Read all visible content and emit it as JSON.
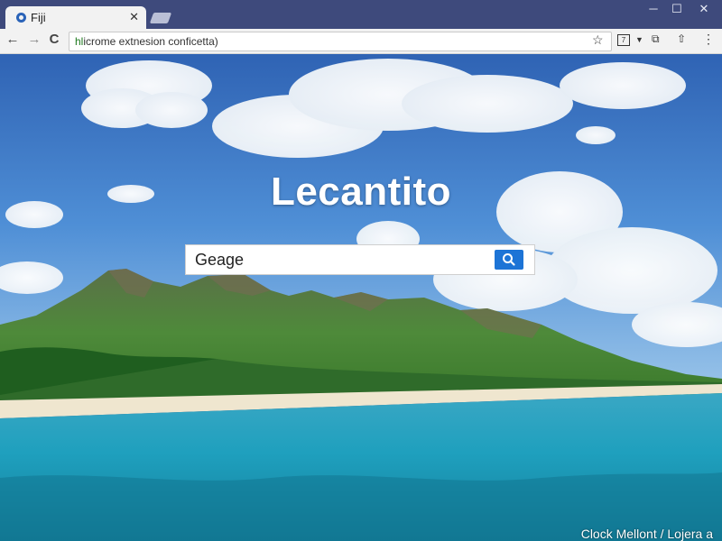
{
  "browser": {
    "tab": {
      "title": "Fiji",
      "close_label": "✕"
    },
    "window_controls": {
      "minimize": "─",
      "maximize": "☐",
      "close": "✕"
    },
    "nav": {
      "back": "←",
      "forward": "→",
      "reload": "C"
    },
    "address_bar": {
      "scheme": "hl",
      "rest": "icrome extnesion conficetta)"
    },
    "toolbar_icons": [
      "star-icon",
      "extension-icon",
      "menu-dropdown-icon",
      "puzzle-icon",
      "share-icon",
      "more-icon"
    ]
  },
  "page": {
    "logo_text": "Lecantito",
    "search": {
      "value": "Geage"
    },
    "caption": "Clock Mellont / Lojera a"
  },
  "colors": {
    "titlebar": "#3e4a7c",
    "accent": "#1d74d6"
  }
}
